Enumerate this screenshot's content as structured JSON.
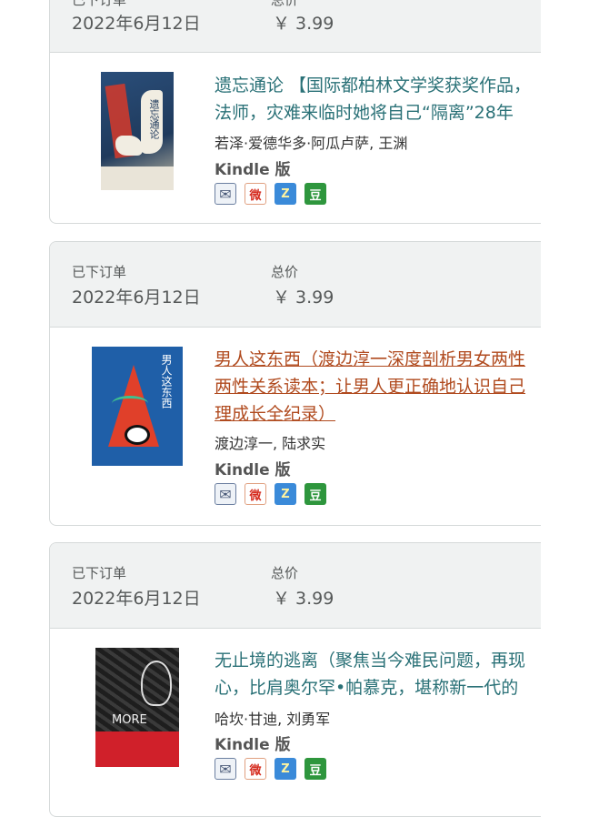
{
  "orders": [
    {
      "order_label": "已下订单",
      "order_date": "2022年6月12日",
      "total_label": "总价",
      "total_value": "￥ 3.99",
      "book": {
        "title_lines": [
          "遗忘通论 【国际都柏林文学奖获奖作品，",
          "法师，灾难来临时她将自己“隔离”28年"
        ],
        "author": "若泽·爱德华多·阿瓜卢萨, 王渊",
        "format": "Kindle 版",
        "cover_text": "遗忘通论",
        "cover_colors": {
          "bg": "#1f3a5c",
          "accent": "#d63a2a"
        }
      }
    },
    {
      "order_label": "已下订单",
      "order_date": "2022年6月12日",
      "total_label": "总价",
      "total_value": "￥ 3.99",
      "book": {
        "title_lines": [
          "男人这东西（渡边淳一深度剖析男女两性",
          "两性关系读本；让男人更正确地认识自己",
          "理成长全纪录）"
        ],
        "author": "渡边淳一, 陆求实",
        "format": "Kindle 版",
        "cover_text": "男人这东西",
        "cover_colors": {
          "bg": "#1f5fa8",
          "accent": "#e0402a"
        }
      }
    },
    {
      "order_label": "已下订单",
      "order_date": "2022年6月12日",
      "total_label": "总价",
      "total_value": "￥ 3.99",
      "book": {
        "title_lines": [
          "无止境的逃离（聚焦当今难民问题，再现",
          "心，比肩奥尔罕•帕慕克，堪称新一代的"
        ],
        "author": "哈坎·甘迪, 刘勇军",
        "format": "Kindle 版",
        "cover_text": "MORE",
        "cover_colors": {
          "bg": "#2b2b2b",
          "accent": "#d0202a"
        }
      }
    }
  ],
  "share_icons": [
    {
      "name": "mail-icon",
      "glyph": "✉"
    },
    {
      "name": "weibo-icon",
      "glyph": "微"
    },
    {
      "name": "qzone-icon",
      "glyph": "Z"
    },
    {
      "name": "douban-icon",
      "glyph": "豆"
    }
  ]
}
